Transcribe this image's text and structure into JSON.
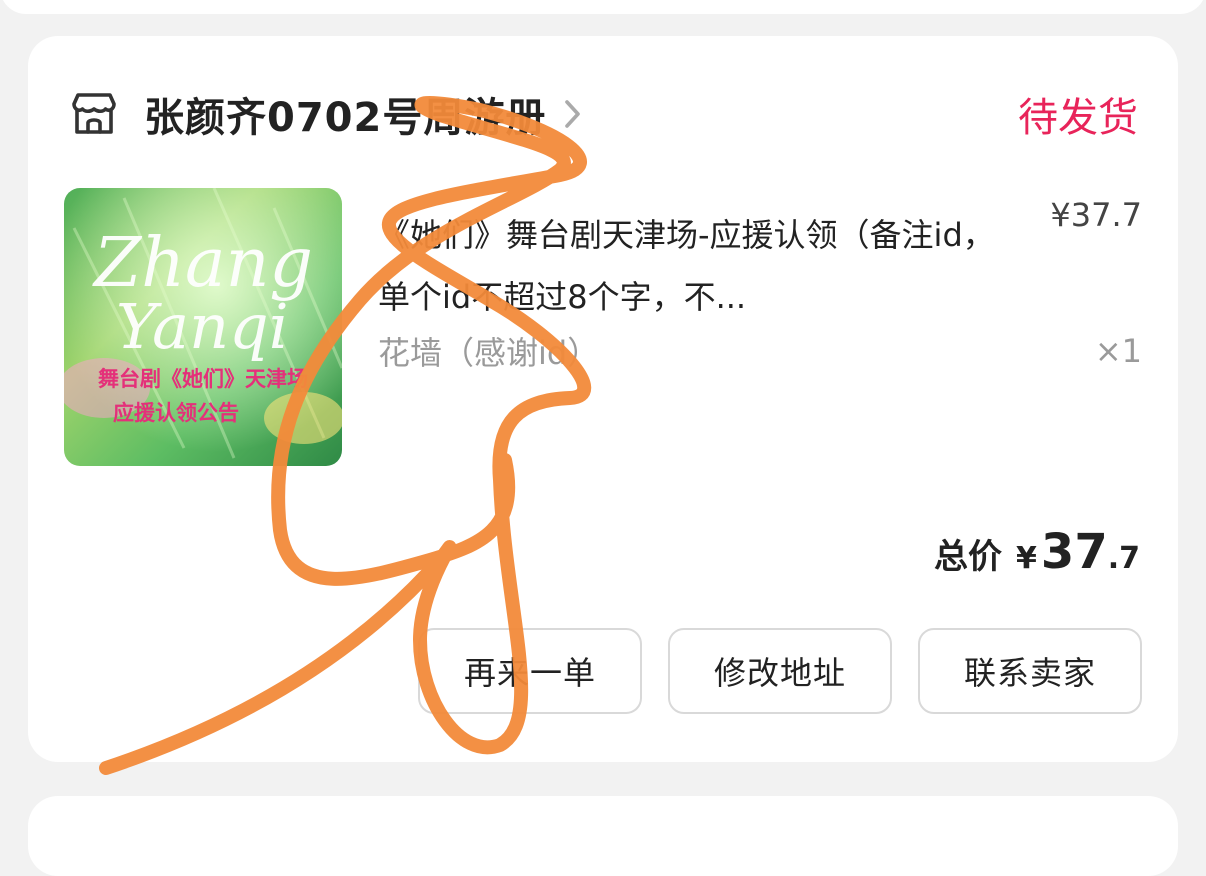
{
  "shop": {
    "name": "张颜齐0702号周游册",
    "icon": "store-icon",
    "chevron_icon": "chevron-right-icon",
    "status": "待发货",
    "status_color": "#e8245a"
  },
  "product": {
    "image_text": {
      "script_line1": "Zhang",
      "script_line2": "Yanqi",
      "banner_line1": "舞台剧《她们》天津场",
      "banner_line2": "应援认领公告"
    },
    "title": "《她们》舞台剧天津场-应援认领（备注id，单个id不超过8个字，不...",
    "spec": "花墙（感谢id）",
    "price": "¥37.7",
    "quantity": "×1"
  },
  "summary": {
    "label": "总价",
    "currency": "¥",
    "amount_int": "37",
    "amount_dec": ".7"
  },
  "actions": [
    {
      "label": "再来一单"
    },
    {
      "label": "修改地址"
    },
    {
      "label": "联系卖家"
    }
  ],
  "annotation_color": "#f28a3a"
}
